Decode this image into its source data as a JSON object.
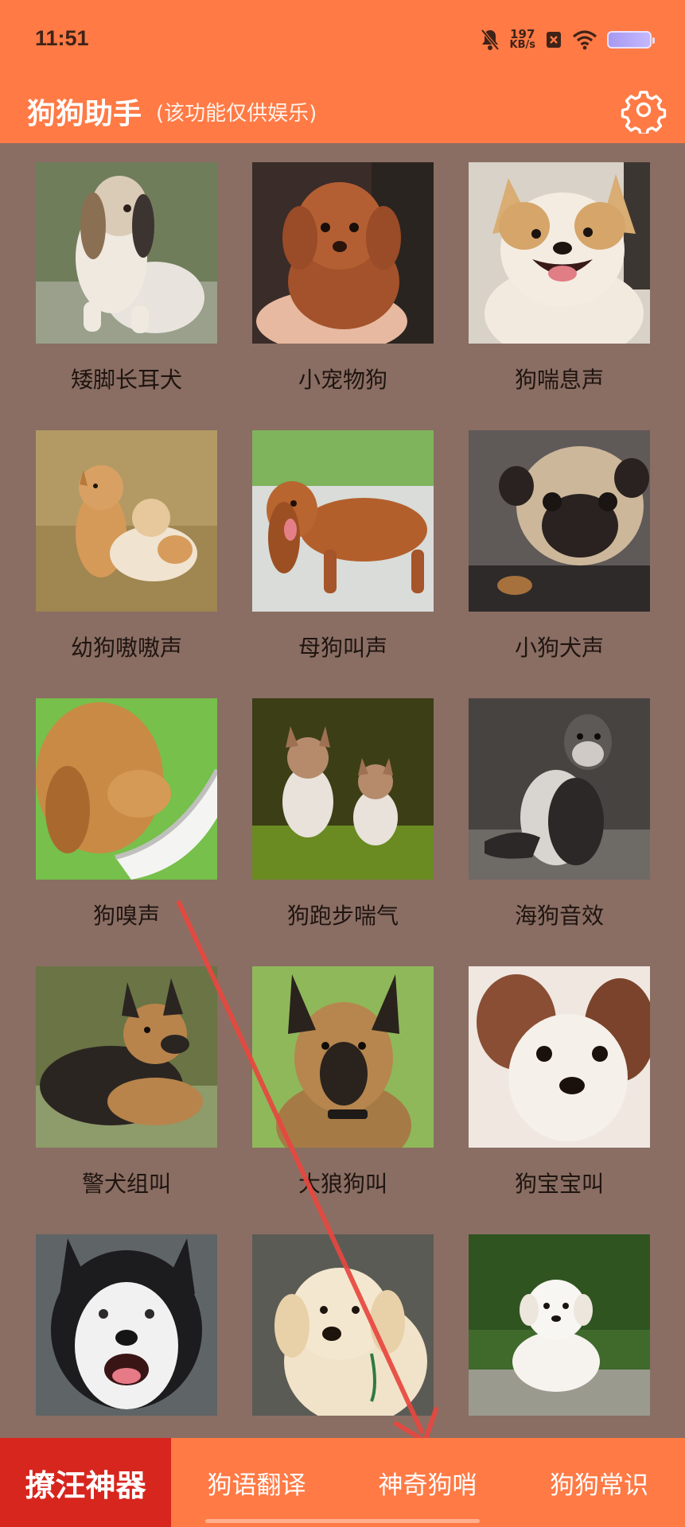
{
  "status_bar": {
    "time": "11:51",
    "net_speed_value": "197",
    "net_speed_unit": "KB/s",
    "icons": [
      "bell-muted-icon",
      "sim-icon",
      "wifi-icon",
      "battery-icon"
    ]
  },
  "header": {
    "title": "狗狗助手",
    "subtitle": "(该功能仅供娱乐)",
    "settings_icon": "gear-icon"
  },
  "sounds": [
    {
      "label": "矮脚长耳犬",
      "image": "basset-hound-photo"
    },
    {
      "label": "小宠物狗",
      "image": "toy-poodle-puppy-photo"
    },
    {
      "label": "狗喘息声",
      "image": "corgi-face-photo"
    },
    {
      "label": "幼狗嗷嗷声",
      "image": "two-puppies-grass-photo"
    },
    {
      "label": "母狗叫声",
      "image": "cocker-spaniel-photo"
    },
    {
      "label": "小狗犬声",
      "image": "pug-face-photo"
    },
    {
      "label": "狗嗅声",
      "image": "retriever-sniffing-bowl-photo"
    },
    {
      "label": "狗跑步喘气",
      "image": "corgi-puppies-running-photo"
    },
    {
      "label": "海狗音效",
      "image": "seal-photo"
    },
    {
      "label": "警犬组叫",
      "image": "german-shepherd-lying-photo"
    },
    {
      "label": "大狼狗叫",
      "image": "german-shepherd-portrait-photo"
    },
    {
      "label": "狗宝宝叫",
      "image": "puppy-closeup-photo"
    },
    {
      "label": "",
      "image": "husky-face-photo"
    },
    {
      "label": "",
      "image": "labrador-puppy-photo"
    },
    {
      "label": "",
      "image": "white-puppy-grass-photo"
    }
  ],
  "bottom_nav": [
    {
      "label": "撩汪神器",
      "active": true
    },
    {
      "label": "狗语翻译",
      "active": false
    },
    {
      "label": "神奇狗哨",
      "active": false
    },
    {
      "label": "狗狗常识",
      "active": false
    }
  ],
  "colors": {
    "header": "#ff7a45",
    "background": "#8a6e63",
    "active_tab": "#d7261e",
    "annotation_arrow": "#e8473f"
  }
}
